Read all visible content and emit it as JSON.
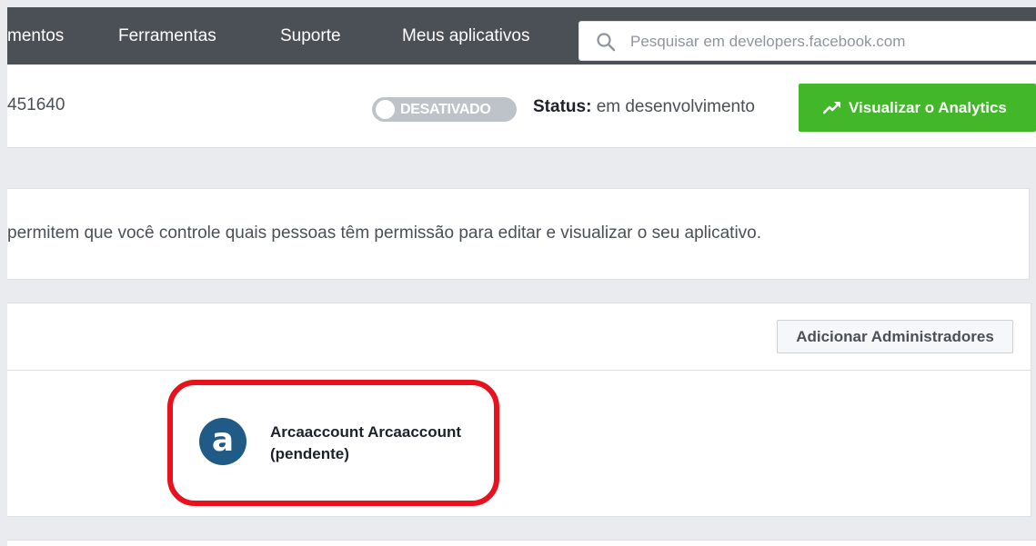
{
  "nav": {
    "items": [
      {
        "label": "mentos"
      },
      {
        "label": "Ferramentas"
      },
      {
        "label": "Suporte"
      },
      {
        "label": "Meus aplicativos"
      }
    ],
    "search_placeholder": "Pesquisar em developers.facebook.com"
  },
  "app_header": {
    "app_id": "451640",
    "mode_toggle_label": "DESATIVADO",
    "status_label": "Status:",
    "status_value": "em desenvolvimento",
    "analytics_button": "Visualizar o Analytics",
    "analytics_icon": "trending-up-icon"
  },
  "roles": {
    "description": "permitem que você controle quais pessoas têm permissão para editar e visualizar o seu aplicativo.",
    "add_admins_button": "Adicionar Administradores",
    "members": [
      {
        "avatar_letter": "a",
        "name": "Arcaaccount Arcaaccount",
        "state": "(pendente)"
      }
    ]
  },
  "colors": {
    "nav_bg": "#4b4f56",
    "primary_green": "#42b72a",
    "highlight_red": "#e8111c",
    "avatar_blue": "#1f5b86"
  }
}
